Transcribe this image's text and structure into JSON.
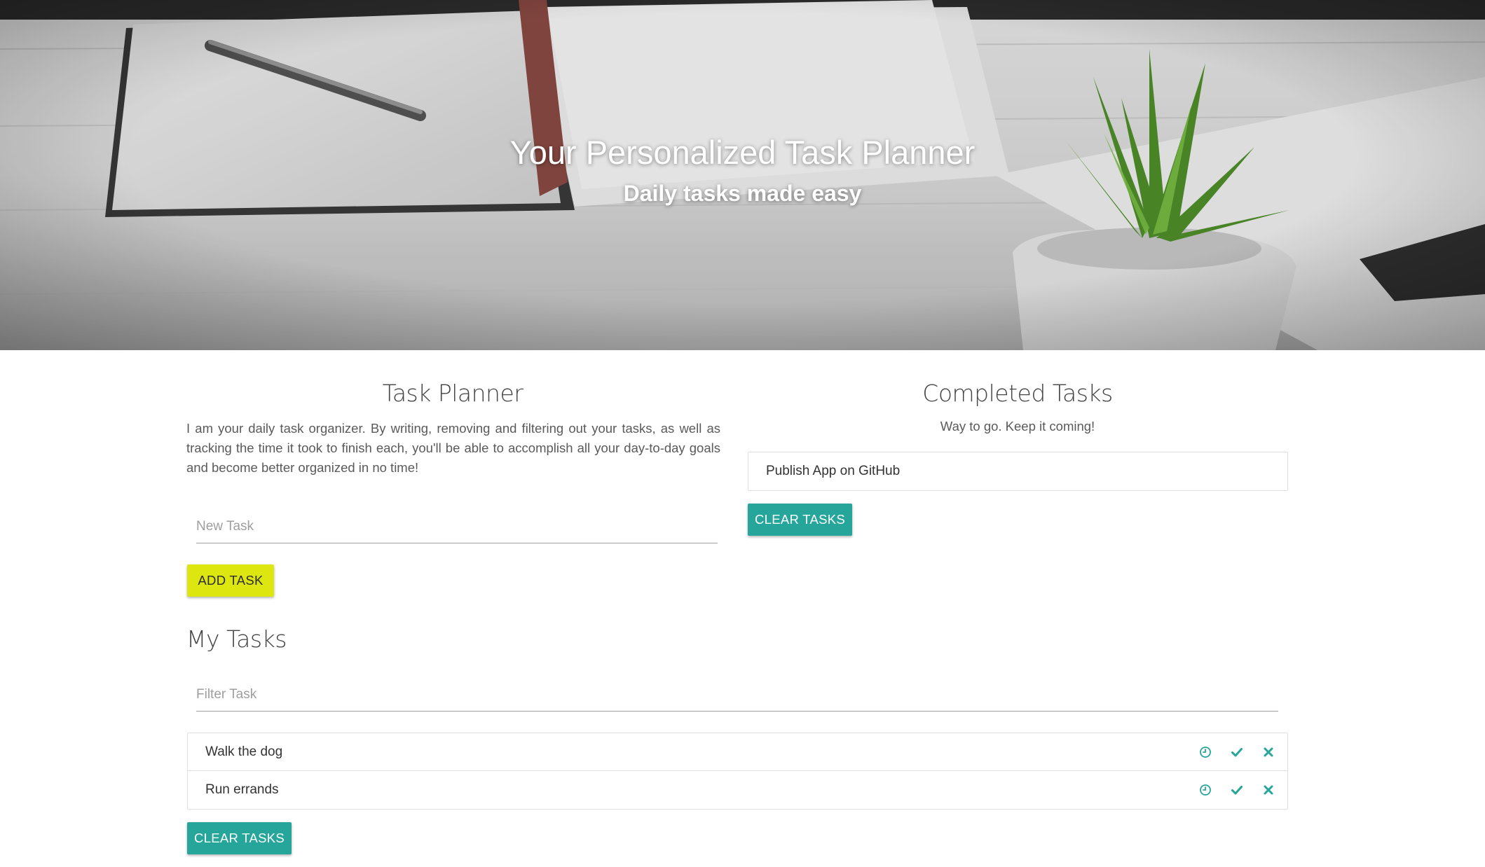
{
  "hero": {
    "title": "Your Personalized Task Planner",
    "subtitle": "Daily tasks made easy"
  },
  "planner": {
    "title": "Task Planner",
    "description": "I am your daily task organizer. By writing, removing and filtering out your tasks, as well as tracking the time it took to finish each, you'll be able to accomplish all your day-to-day goals and become better organized in no time!",
    "new_task_placeholder": "New Task",
    "add_button_label": "ADD TASK"
  },
  "my_tasks": {
    "title": "My Tasks",
    "filter_placeholder": "Filter Task",
    "items": [
      {
        "label": "Walk the dog"
      },
      {
        "label": "Run errands"
      }
    ],
    "clear_button_label": "CLEAR TASKS"
  },
  "completed": {
    "title": "Completed Tasks",
    "description": "Way to go. Keep it coming!",
    "items": [
      {
        "label": "Publish App on GitHub"
      }
    ],
    "clear_button_label": "CLEAR TASKS"
  },
  "colors": {
    "accent_teal": "#26a69a",
    "accent_yellow": "#dde60f"
  },
  "icons": {
    "timer": "clock-icon",
    "complete": "check-icon",
    "remove": "close-icon"
  }
}
